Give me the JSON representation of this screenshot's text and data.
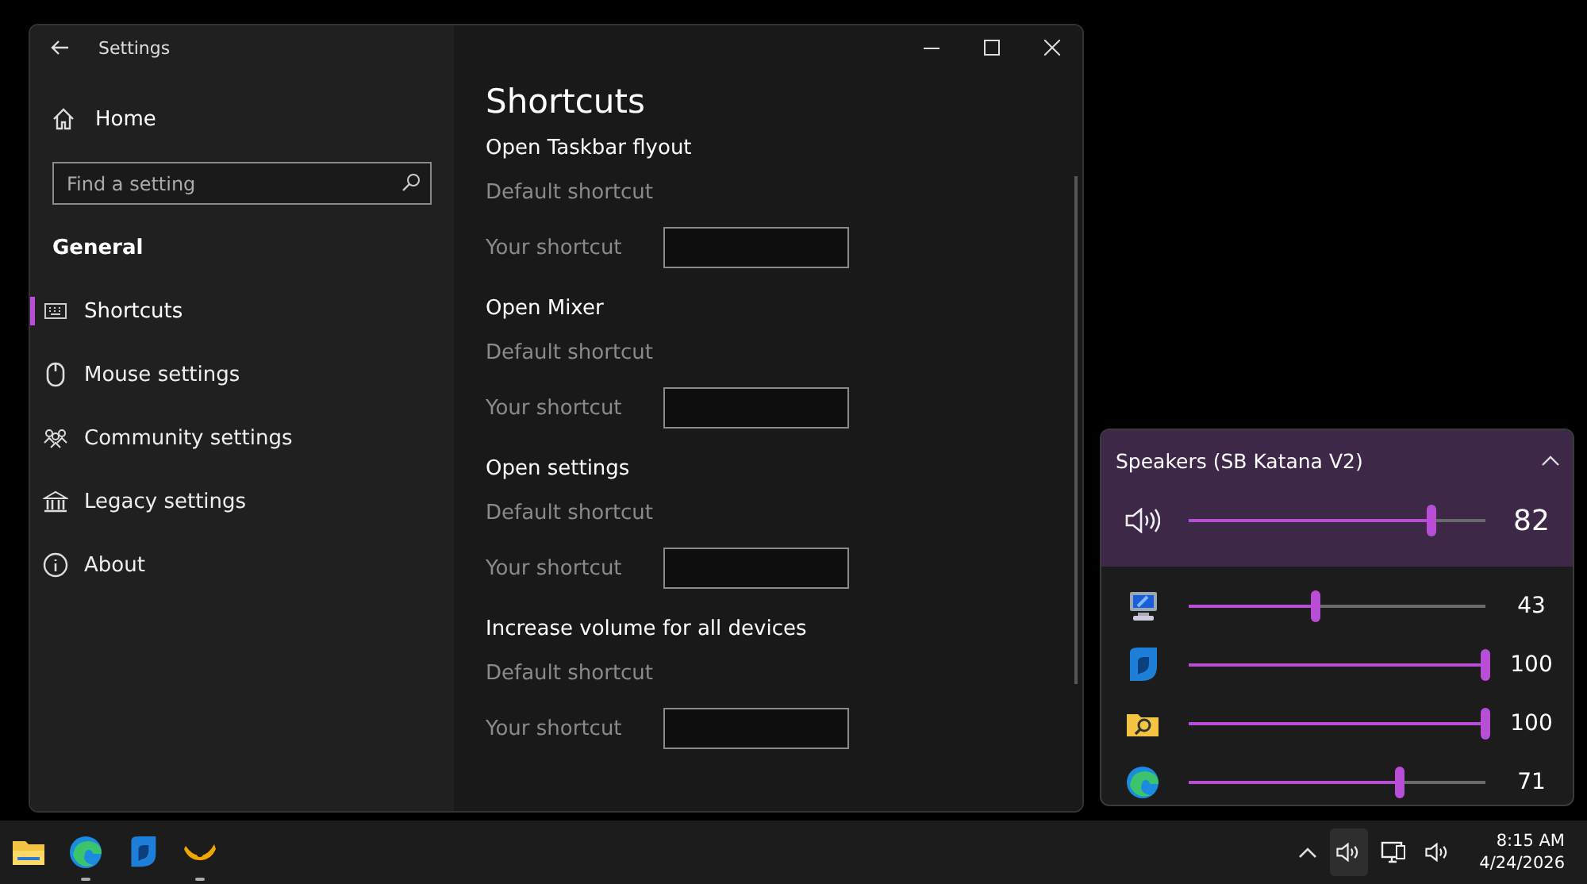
{
  "window": {
    "title": "Settings"
  },
  "nav": {
    "home": "Home",
    "search_placeholder": "Find a setting",
    "section": "General",
    "items": [
      {
        "label": "Shortcuts",
        "selected": true
      },
      {
        "label": "Mouse settings",
        "selected": false
      },
      {
        "label": "Community settings",
        "selected": false
      },
      {
        "label": "Legacy settings",
        "selected": false
      },
      {
        "label": "About",
        "selected": false
      }
    ]
  },
  "content": {
    "title": "Shortcuts",
    "groups": [
      {
        "title": "Open Taskbar flyout",
        "default_label": "Default shortcut",
        "your_label": "Your shortcut"
      },
      {
        "title": "Open Mixer",
        "default_label": "Default shortcut",
        "your_label": "Your shortcut"
      },
      {
        "title": "Open settings",
        "default_label": "Default shortcut",
        "your_label": "Your shortcut"
      },
      {
        "title": "Increase volume for all devices",
        "default_label": "Default shortcut",
        "your_label": "Your shortcut"
      }
    ]
  },
  "flyout": {
    "device": "Speakers (SB Katana V2)",
    "master": {
      "level": 0.82,
      "reading": "82"
    },
    "apps": [
      {
        "level": 0.43,
        "reading": "43"
      },
      {
        "level": 1,
        "reading": "100"
      },
      {
        "level": 1,
        "reading": "100"
      },
      {
        "level": 0.71,
        "reading": "71"
      }
    ]
  },
  "taskbar": {
    "apps": [
      {
        "running": false
      },
      {
        "running": true
      },
      {
        "running": false
      },
      {
        "running": true
      }
    ],
    "time": "8:15 AM",
    "date": "4/24/2026"
  }
}
